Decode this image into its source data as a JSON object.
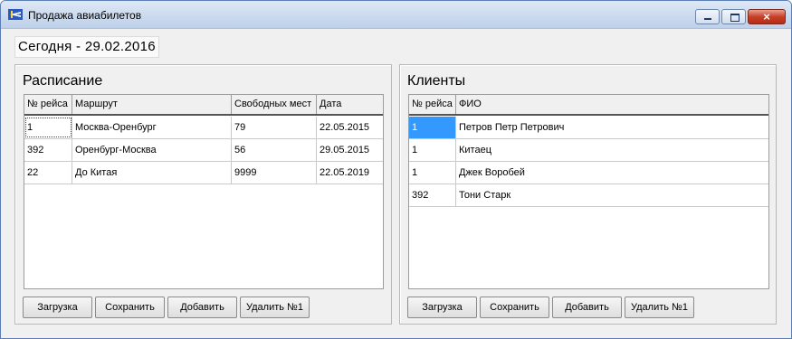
{
  "window": {
    "title": "Продажа авиабилетов",
    "close_glyph": "×",
    "icon": "airplane-app-icon"
  },
  "today_label": "Сегодня - 29.02.2016",
  "schedule": {
    "title": "Расписание",
    "columns": [
      "№ рейса",
      "Маршрут",
      "Свободных мест",
      "Дата"
    ],
    "rows": [
      [
        "1",
        "Москва-Оренбург",
        "79",
        "22.05.2015"
      ],
      [
        "392",
        "Оренбург-Москва",
        "56",
        "29.05.2015"
      ],
      [
        "22",
        "До Китая",
        "9999",
        "22.05.2019"
      ]
    ],
    "buttons": {
      "load": "Загрузка",
      "save": "Сохранить",
      "add": "Добавить",
      "delete": "Удалить №1"
    }
  },
  "clients": {
    "title": "Клиенты",
    "columns": [
      "№ рейса",
      "ФИО"
    ],
    "rows": [
      [
        "1",
        "Петров Петр Петрович"
      ],
      [
        "1",
        "Китаец"
      ],
      [
        "1",
        "Джек Воробей"
      ],
      [
        "392",
        "Тони Старк"
      ]
    ],
    "buttons": {
      "load": "Загрузка",
      "save": "Сохранить",
      "add": "Добавить",
      "delete": "Удалить №1"
    }
  },
  "colors": {
    "selection": "#3399ff",
    "window_border": "#5b7fb5",
    "close_button": "#c8412a"
  }
}
